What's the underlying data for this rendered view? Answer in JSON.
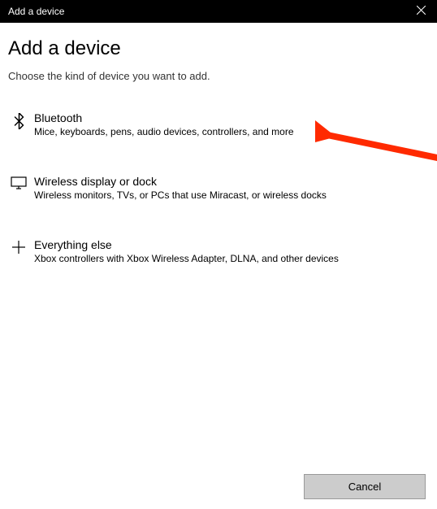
{
  "titlebar": {
    "title": "Add a device"
  },
  "header": {
    "heading": "Add a device",
    "subtitle": "Choose the kind of device you want to add."
  },
  "options": [
    {
      "title": "Bluetooth",
      "desc": "Mice, keyboards, pens, audio devices, controllers, and more"
    },
    {
      "title": "Wireless display or dock",
      "desc": "Wireless monitors, TVs, or PCs that use Miracast, or wireless docks"
    },
    {
      "title": "Everything else",
      "desc": "Xbox controllers with Xbox Wireless Adapter, DLNA, and other devices"
    }
  ],
  "footer": {
    "cancel": "Cancel"
  }
}
